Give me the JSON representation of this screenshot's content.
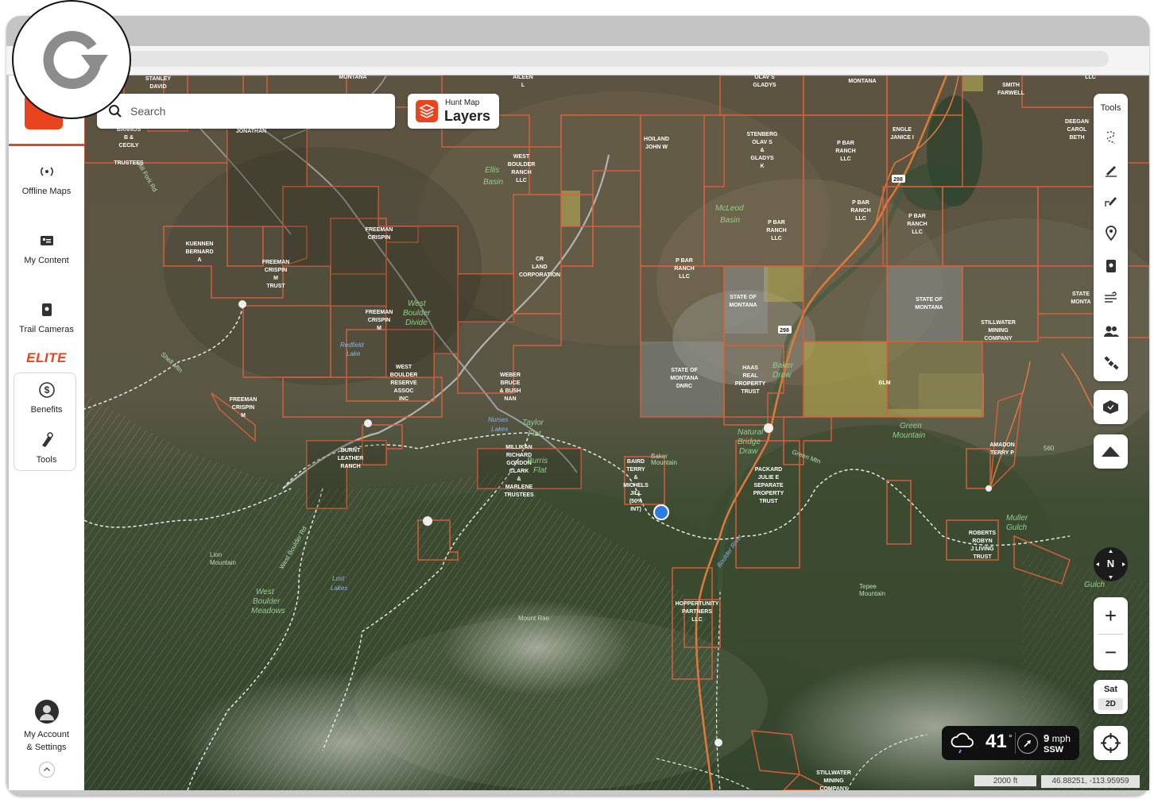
{
  "app": {
    "name": "onX Hunt",
    "accent_color": "#e8441f"
  },
  "browser": {
    "reload_icon": "reload-icon"
  },
  "sidebar": {
    "items": [
      {
        "label": "Offline Maps",
        "icon": "offline-maps-icon"
      },
      {
        "label": "My Content",
        "icon": "my-content-icon"
      },
      {
        "label": "Trail Cameras",
        "icon": "trail-camera-icon"
      }
    ],
    "elite_label": "ELITE",
    "elite_items": [
      {
        "label": "Benefits",
        "icon": "dollar-icon"
      },
      {
        "label": "Tools",
        "icon": "tools-icon"
      }
    ],
    "account_label_line1": "My Account",
    "account_label_line2": "& Settings"
  },
  "search": {
    "placeholder": "Search"
  },
  "layers_button": {
    "sub": "Hunt Map",
    "main": "Layers"
  },
  "tools_panel": {
    "title": "Tools",
    "tools": [
      "lasso-icon",
      "draw-line-icon",
      "draw-shape-icon",
      "waypoint-icon",
      "trail-camera-tool-icon",
      "wind-icon",
      "landowner-icon",
      "satellite-icon"
    ]
  },
  "map_controls": {
    "compass_label": "N",
    "zoom_in": "+",
    "zoom_out": "−",
    "basemap_label": "Sat",
    "view_mode": "2D"
  },
  "weather": {
    "temperature": "41",
    "degree": "°",
    "wind_speed": "9",
    "wind_unit": "mph",
    "wind_direction": "SSW"
  },
  "scale_bar": "2000 ft",
  "coordinates": "46.88251, -113.95959",
  "map_labels": {
    "owners": [
      [
        "STANLEY",
        "DAVID"
      ],
      [
        "BANNOS",
        "B &",
        "CECILY",
        "TRUSTEES"
      ],
      [
        "JONATHAN"
      ],
      [
        "KUENNEN",
        "BERNARD",
        "A"
      ],
      [
        "FREEMAN",
        "CRISPIN"
      ],
      [
        "FREEMAN",
        "CRISPIN",
        "M",
        "TRUST"
      ],
      [
        "FREEMAN",
        "CRISPIN",
        "M"
      ],
      [
        "FREEMAN",
        "CRISPIN",
        "M"
      ],
      [
        "WEST",
        "BOULDER",
        "RESERVE",
        "ASSOC",
        "INC"
      ],
      [
        "BURNT",
        "LEATHER",
        "RANCH"
      ],
      [
        "WEBER",
        "BRUCE",
        "& BUSH",
        "NAN"
      ],
      [
        "MILLIKAN",
        "RICHARD",
        "GORDON",
        "CLARK",
        "&",
        "MARLENE",
        "TRUSTEES"
      ],
      [
        "WEST",
        "BOULDER",
        "RANCH",
        "LLC"
      ],
      [
        "CR",
        "LAND",
        "CORPORATION"
      ],
      [
        "HOILAND",
        "JOHN W"
      ],
      [
        "P BAR",
        "RANCH",
        "LLC"
      ],
      [
        "BAIRD",
        "TERRY",
        "&",
        "MICHELS",
        "JILL",
        "(50%",
        "INT)"
      ],
      [
        "STATE OF",
        "MONTANA",
        "DNRC"
      ],
      [
        "STATE OF",
        "MONTANA"
      ],
      [
        "HAAS",
        "REAL",
        "PROPERTY",
        "TRUST"
      ],
      [
        "PACKARD",
        "JULIE E",
        "SEPARATE",
        "PROPERTY",
        "TRUST"
      ],
      [
        "HOPPERTUNITY",
        "PARTNERS",
        "LLC"
      ],
      [
        "STENBERG",
        "OLAV S",
        "&",
        "GLADYS",
        "K"
      ],
      [
        "OLAV S",
        "GLADYS"
      ],
      [
        "MONTANA"
      ],
      [
        "P BAR",
        "RANCH",
        "LLC"
      ],
      [
        "P BAR",
        "RANCH",
        "LLC"
      ],
      [
        "P BAR",
        "RANCH",
        "LLC"
      ],
      [
        "ENGLE",
        "JANICE I"
      ],
      [
        "SMITH",
        "FARWELL"
      ],
      [
        "DEEGAN",
        "CAROL",
        "BETH"
      ],
      [
        "STATE OF",
        "MONTANA"
      ],
      [
        "STILLWATER",
        "MINING",
        "COMPANY"
      ],
      [
        "STATE",
        "MONTA"
      ],
      [
        "BLM"
      ],
      [
        "AMADON",
        "TERRY P"
      ],
      [
        "ROBERTS",
        "ROBYN",
        "J LIVING",
        "TRUST"
      ],
      [
        "STILLWATER",
        "MINING",
        "COMPANY"
      ],
      [
        "AILEEN",
        "L"
      ],
      [
        "MONTANA"
      ],
      [
        "STATE OF",
        "MONTANA"
      ],
      [
        "HAAS",
        "REAL",
        "PROPERTY",
        "TRUST"
      ]
    ],
    "places": [
      "Ellis",
      "Basin",
      "McLeod",
      "Basin",
      "West",
      "Boulder",
      "Divide",
      "Taylor",
      "Flat",
      "Burris",
      "Flat",
      "Baker",
      "Draw",
      "Green",
      "Mountain",
      "Natural",
      "Bridge",
      "Draw",
      "Muller",
      "Gulch",
      "Gulch",
      "West",
      "Boulder",
      "Meadows"
    ],
    "water": [
      "Redfield",
      "Lake",
      "Nurses",
      "Lakes",
      "Lost",
      "Lakes",
      "Boulder River"
    ],
    "mountains": [
      "Baker",
      "Mountain",
      "Lion",
      "Mountain",
      "Mount Rae",
      "Tepee",
      "Mountain"
    ],
    "roads": [
      "Shell Mtn",
      "Green Mtn",
      "West Boulder Rd",
      "Mill Fork Rd",
      "298",
      "298",
      "560"
    ]
  }
}
